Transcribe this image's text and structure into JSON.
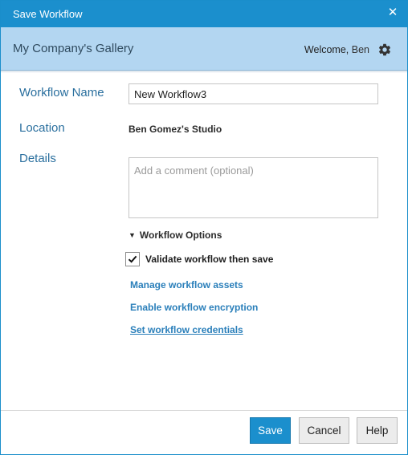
{
  "dialog": {
    "title": "Save Workflow",
    "close_glyph": "✕"
  },
  "gallery": {
    "name": "My Company's Gallery",
    "welcome": "Welcome,",
    "user": "Ben",
    "settings_icon": "gear-icon"
  },
  "form": {
    "workflow_name_label": "Workflow Name",
    "workflow_name_value": "New Workflow3",
    "location_label": "Location",
    "location_value": "Ben Gomez's Studio",
    "details_label": "Details",
    "details_placeholder": "Add a comment (optional)"
  },
  "options": {
    "toggle_label": "Workflow Options",
    "toggle_glyph": "▼",
    "validate_label": "Validate workflow then save",
    "validate_checked": true,
    "links": [
      {
        "label": "Manage workflow assets"
      },
      {
        "label": "Enable workflow encryption"
      },
      {
        "label": "Set workflow credentials"
      }
    ]
  },
  "footer": {
    "save_label": "Save",
    "cancel_label": "Cancel",
    "help_label": "Help"
  },
  "colors": {
    "titlebar": "#1b8fcd",
    "gallery_bar": "#b3d6f1",
    "label_blue": "#2a6f9e",
    "link_blue": "#2a7fba"
  }
}
